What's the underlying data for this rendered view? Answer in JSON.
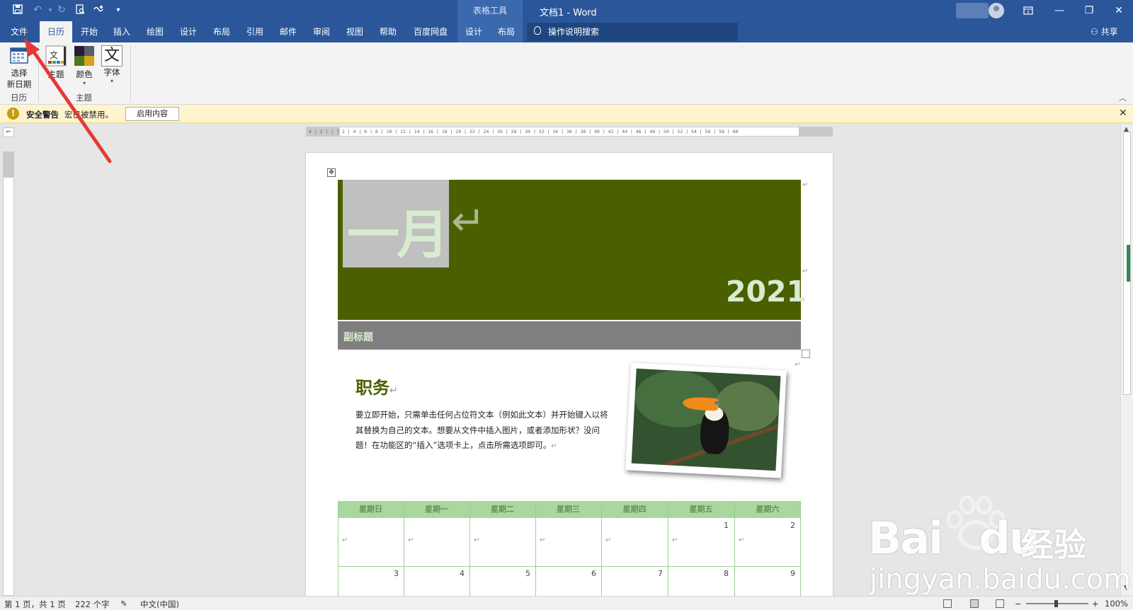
{
  "titlebar": {
    "quick_access": [
      "save-icon",
      "undo-icon",
      "redo-icon",
      "print-preview-icon",
      "touch-mode-icon",
      "customize-icon"
    ],
    "context_tools_label": "表格工具",
    "doc_title": "文档1 - Word",
    "window_buttons": [
      "ribbon-display-options-icon",
      "minimize-icon",
      "restore-icon",
      "close-icon"
    ],
    "colors": {
      "brand": "#2b579a",
      "context": "#3b69ad"
    }
  },
  "tabs": [
    {
      "label": "文件"
    },
    {
      "label": "日历",
      "active": true
    },
    {
      "label": "开始"
    },
    {
      "label": "插入"
    },
    {
      "label": "绘图"
    },
    {
      "label": "设计"
    },
    {
      "label": "布局"
    },
    {
      "label": "引用"
    },
    {
      "label": "邮件"
    },
    {
      "label": "审阅"
    },
    {
      "label": "视图"
    },
    {
      "label": "帮助"
    },
    {
      "label": "百度网盘"
    },
    {
      "label": "设计",
      "context": true
    },
    {
      "label": "布局",
      "context": true
    }
  ],
  "tellme": {
    "label": "操作说明搜索"
  },
  "share": {
    "label": "共享"
  },
  "ribbon": {
    "select_date": {
      "line1": "选择",
      "line2": "新日期"
    },
    "theme": {
      "label": "主题"
    },
    "colors": {
      "label": "颜色"
    },
    "fonts": {
      "label": "字体",
      "icon_glyph": "文"
    },
    "group_calendar": "日历",
    "group_theme": "主题"
  },
  "security_bar": {
    "title": "安全警告",
    "message": "宏已被禁用。",
    "enable_button": "启用内容",
    "icon": "!"
  },
  "ruler": {
    "horizontal_text": "4 | 2 | | | 2 | 4 | 6 | 8 | 10 | 12 | 14 | 16 | 18 | 20 | 22 | 24 | 26 | 28 | 30 | 32 | 34 | 36 | 38 | 40 | 42 | 44 | 46 | 48 | 50 | 52 | 54 | 56 | 58 | 60"
  },
  "document": {
    "month": "一月",
    "year": "2021",
    "subtitle": "副标题",
    "heading": "职务",
    "body": "要立即开始，只需单击任何占位符文本（例如此文本）并开始键入以将其替换为自己的文本。想要从文件中插入图片，或者添加形状？没问题！在功能区的“插入”选项卡上，点击所需选项即可。",
    "paragraph_mark": "↵",
    "colors": {
      "banner": "#4a6000",
      "month_text": "#d8ecd0",
      "subtitle_bar": "#7f7f7f",
      "calendar_header": "#a8d8a0"
    }
  },
  "calendar": {
    "days": [
      "星期日",
      "星期一",
      "星期二",
      "星期三",
      "星期四",
      "星期五",
      "星期六"
    ],
    "rows": [
      [
        "",
        "",
        "",
        "",
        "",
        "1",
        "2"
      ],
      [
        "3",
        "4",
        "5",
        "6",
        "7",
        "8",
        "9"
      ]
    ]
  },
  "statusbar": {
    "page": "第 1 页，共 1 页",
    "words": "222 个字",
    "language": "中文(中国)",
    "zoom": "100%"
  },
  "watermark": {
    "brand": "Bai",
    "brand2": "du",
    "jingyan": "经验",
    "url": "jingyan.baidu.com"
  }
}
